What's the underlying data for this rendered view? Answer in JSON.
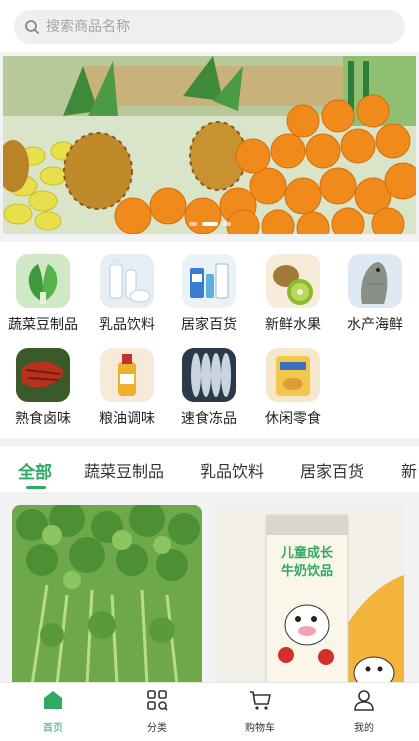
{
  "search": {
    "placeholder": "搜索商品名称",
    "icon": "search-icon"
  },
  "banner": {
    "slides": 3,
    "active_slide": 2
  },
  "categories": [
    {
      "label": "蔬菜豆制品",
      "icon": "vegetables-image"
    },
    {
      "label": "乳品饮料",
      "icon": "dairy-image"
    },
    {
      "label": "居家百货",
      "icon": "household-image"
    },
    {
      "label": "新鲜水果",
      "icon": "fruit-image"
    },
    {
      "label": "水产海鲜",
      "icon": "seafood-image"
    },
    {
      "label": "熟食卤味",
      "icon": "cooked-food-image"
    },
    {
      "label": "粮油调味",
      "icon": "oil-seasoning-image"
    },
    {
      "label": "速食冻品",
      "icon": "frozen-food-image"
    },
    {
      "label": "休闲零食",
      "icon": "snacks-image"
    }
  ],
  "tabs": [
    {
      "label": "全部",
      "active": true
    },
    {
      "label": "蔬菜豆制品"
    },
    {
      "label": "乳品饮料"
    },
    {
      "label": "居家百货"
    },
    {
      "label": "新"
    }
  ],
  "products": [
    {
      "image": "celery-image"
    },
    {
      "image": "milk-drink-image",
      "package_text_1": "儿童成长",
      "package_text_2": "牛奶饮品"
    }
  ],
  "bottom_nav": [
    {
      "label": "首页",
      "icon": "home-icon",
      "active": true
    },
    {
      "label": "分类",
      "icon": "category-icon"
    },
    {
      "label": "购物车",
      "icon": "cart-icon"
    },
    {
      "label": "我的",
      "icon": "user-icon"
    }
  ],
  "colors": {
    "accent": "#2eaa63",
    "background": "#f2f2f2"
  }
}
